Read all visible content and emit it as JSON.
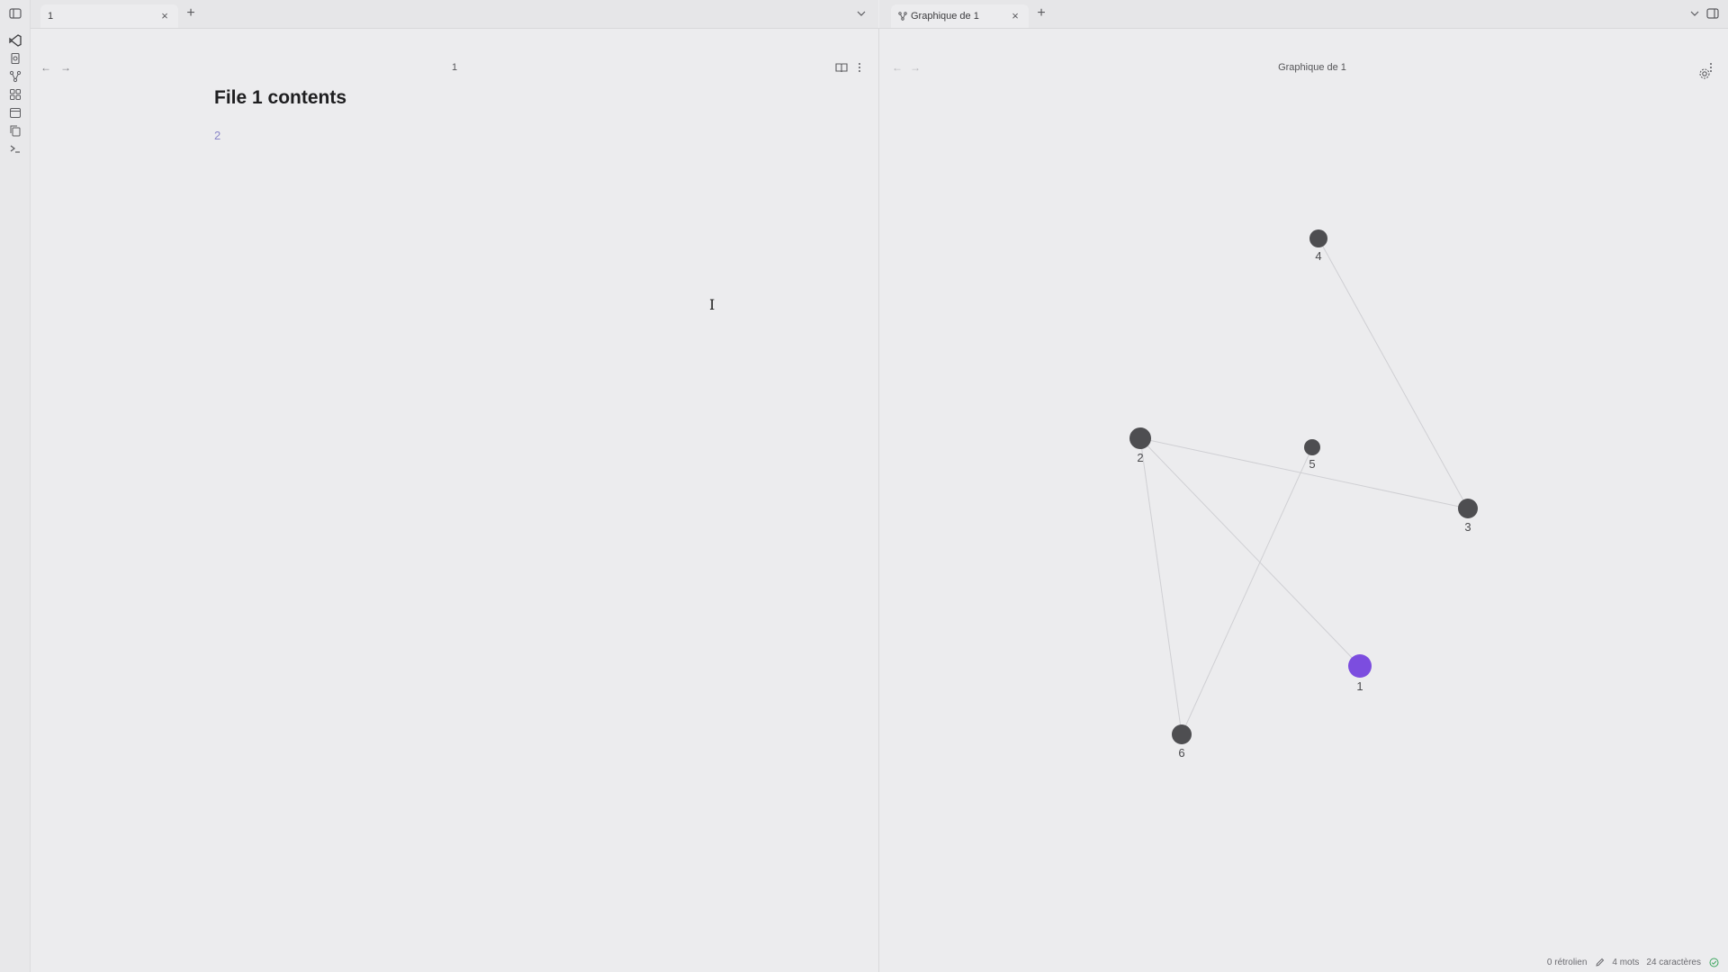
{
  "left_pane": {
    "tab": {
      "label": "1"
    },
    "header_title": "1",
    "document": {
      "heading": "File 1 contents",
      "body_link": "2"
    }
  },
  "right_pane": {
    "tab": {
      "label": "Graphique de 1"
    },
    "header_title": "Graphique de 1",
    "graph": {
      "nodes": [
        {
          "id": "1",
          "label": "1",
          "active": true,
          "color": "#7c4ddf"
        },
        {
          "id": "2",
          "label": "2",
          "active": false,
          "color": "#4e4e51"
        },
        {
          "id": "3",
          "label": "3",
          "active": false,
          "color": "#4e4e51"
        },
        {
          "id": "4",
          "label": "4",
          "active": false,
          "color": "#4e4e51"
        },
        {
          "id": "5",
          "label": "5",
          "active": false,
          "color": "#4e4e51"
        },
        {
          "id": "6",
          "label": "6",
          "active": false,
          "color": "#4e4e51"
        }
      ],
      "edges": [
        [
          "2",
          "1"
        ],
        [
          "2",
          "3"
        ],
        [
          "2",
          "6"
        ],
        [
          "4",
          "3"
        ],
        [
          "5",
          "6"
        ]
      ]
    }
  },
  "status_bar": {
    "backlinks": "0 rétrolien",
    "words": "4 mots",
    "characters": "24 caractères"
  },
  "colors": {
    "accent": "#7c4ddf",
    "node": "#4e4e51",
    "edge": "#cfcfd3",
    "sync_ok": "#3aa55d"
  }
}
